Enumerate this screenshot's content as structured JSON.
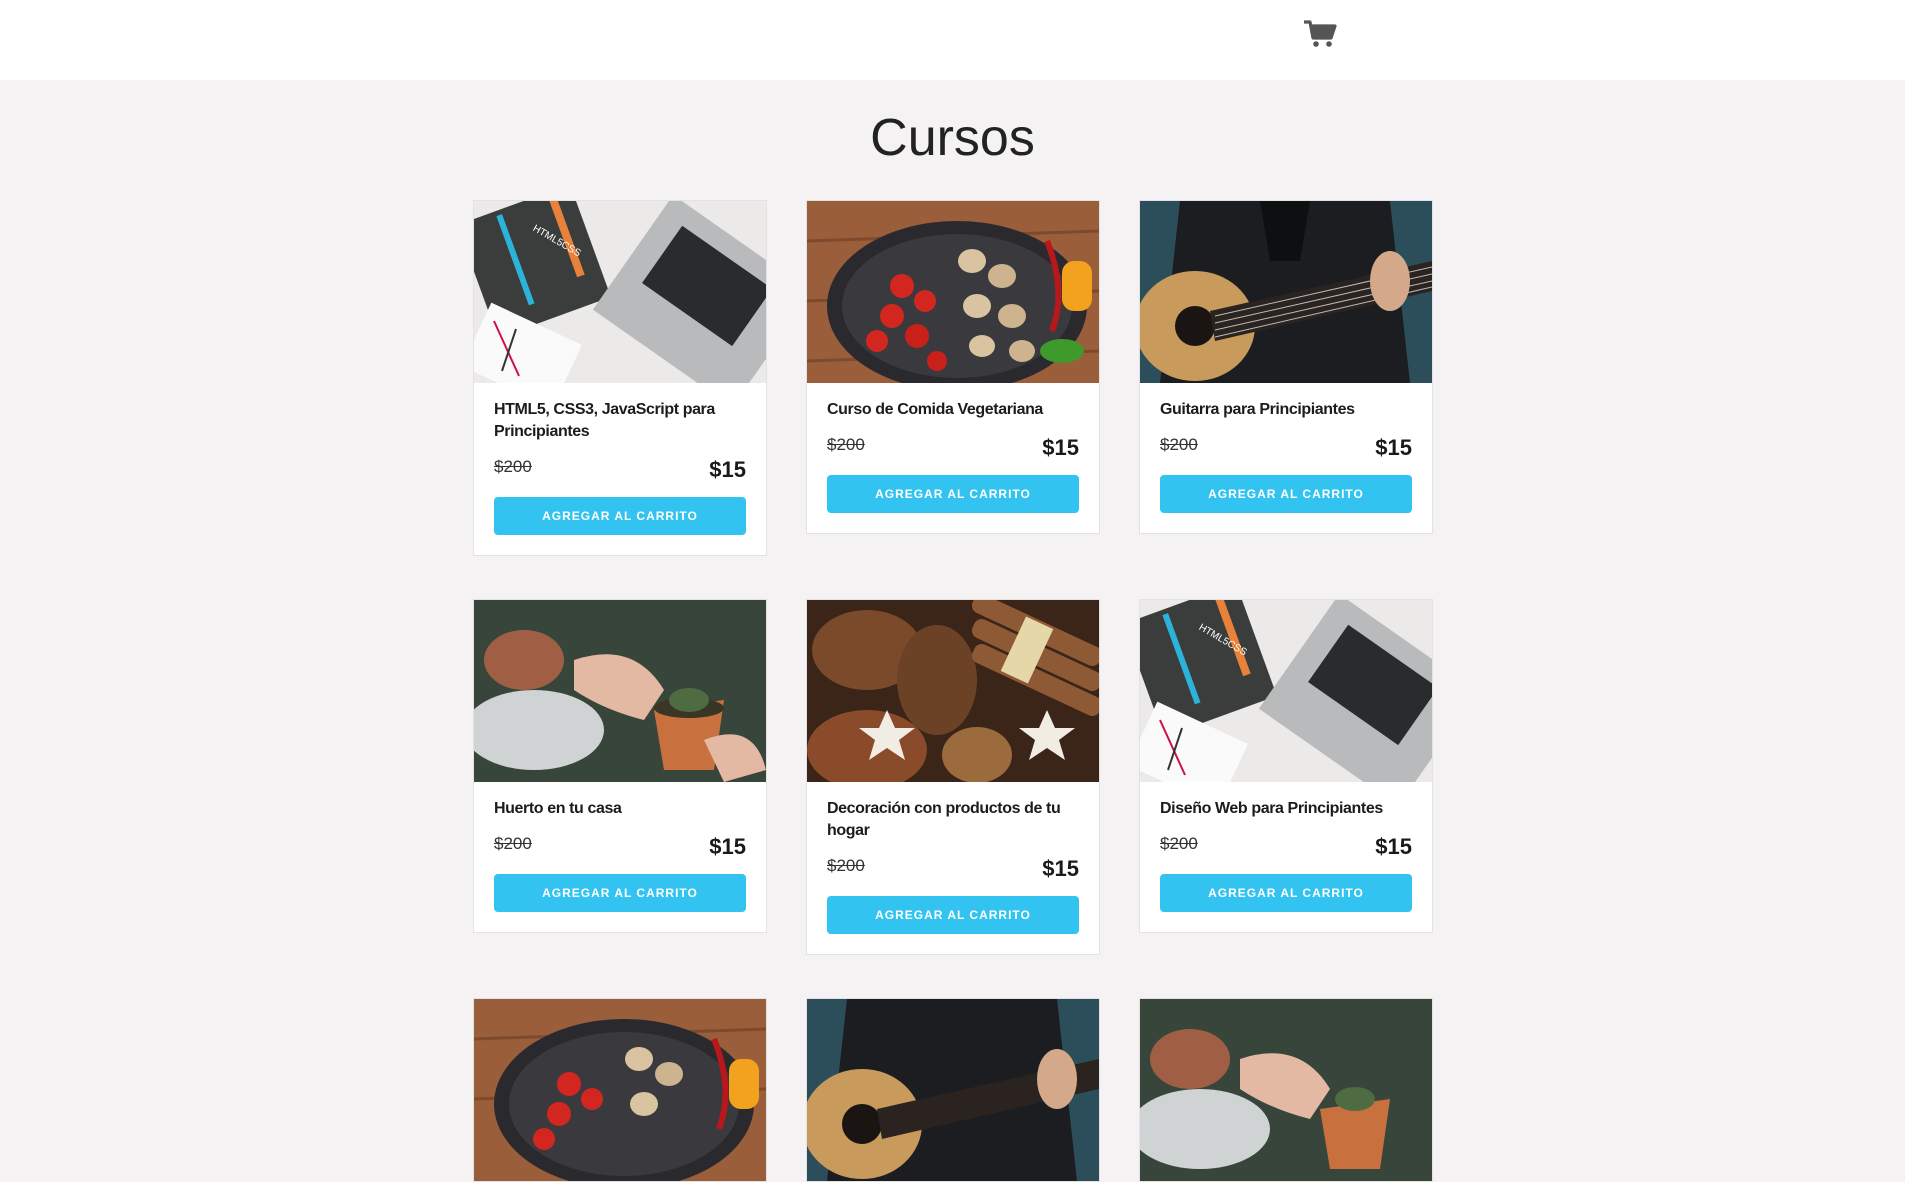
{
  "header": {
    "cart_icon": "shopping-cart-icon"
  },
  "page": {
    "title": "Cursos"
  },
  "courses": [
    {
      "title": "HTML5, CSS3, JavaScript para Principiantes",
      "old_price": "$200",
      "price": "$15",
      "button": "AGREGAR AL CARRITO",
      "image": "laptop-html-book",
      "image_text": "HTML5CSS"
    },
    {
      "title": "Curso de Comida Vegetariana",
      "old_price": "$200",
      "price": "$15",
      "button": "AGREGAR AL CARRITO",
      "image": "vegetable-pan"
    },
    {
      "title": "Guitarra para Principiantes",
      "old_price": "$200",
      "price": "$15",
      "button": "AGREGAR AL CARRITO",
      "image": "guitar-player"
    },
    {
      "title": "Huerto en tu casa",
      "old_price": "$200",
      "price": "$15",
      "button": "AGREGAR AL CARRITO",
      "image": "hands-plant-pot"
    },
    {
      "title": "Decoración con productos de tu hogar",
      "old_price": "$200",
      "price": "$15",
      "button": "AGREGAR AL CARRITO",
      "image": "pinecones-cinnamon"
    },
    {
      "title": "Diseño Web para Principiantes",
      "old_price": "$200",
      "price": "$15",
      "button": "AGREGAR AL CARRITO",
      "image": "laptop-html-book",
      "image_text": "HTML5CSS"
    },
    {
      "image": "vegetable-pan"
    },
    {
      "image": "guitar-player"
    },
    {
      "image": "hands-plant-pot"
    }
  ]
}
